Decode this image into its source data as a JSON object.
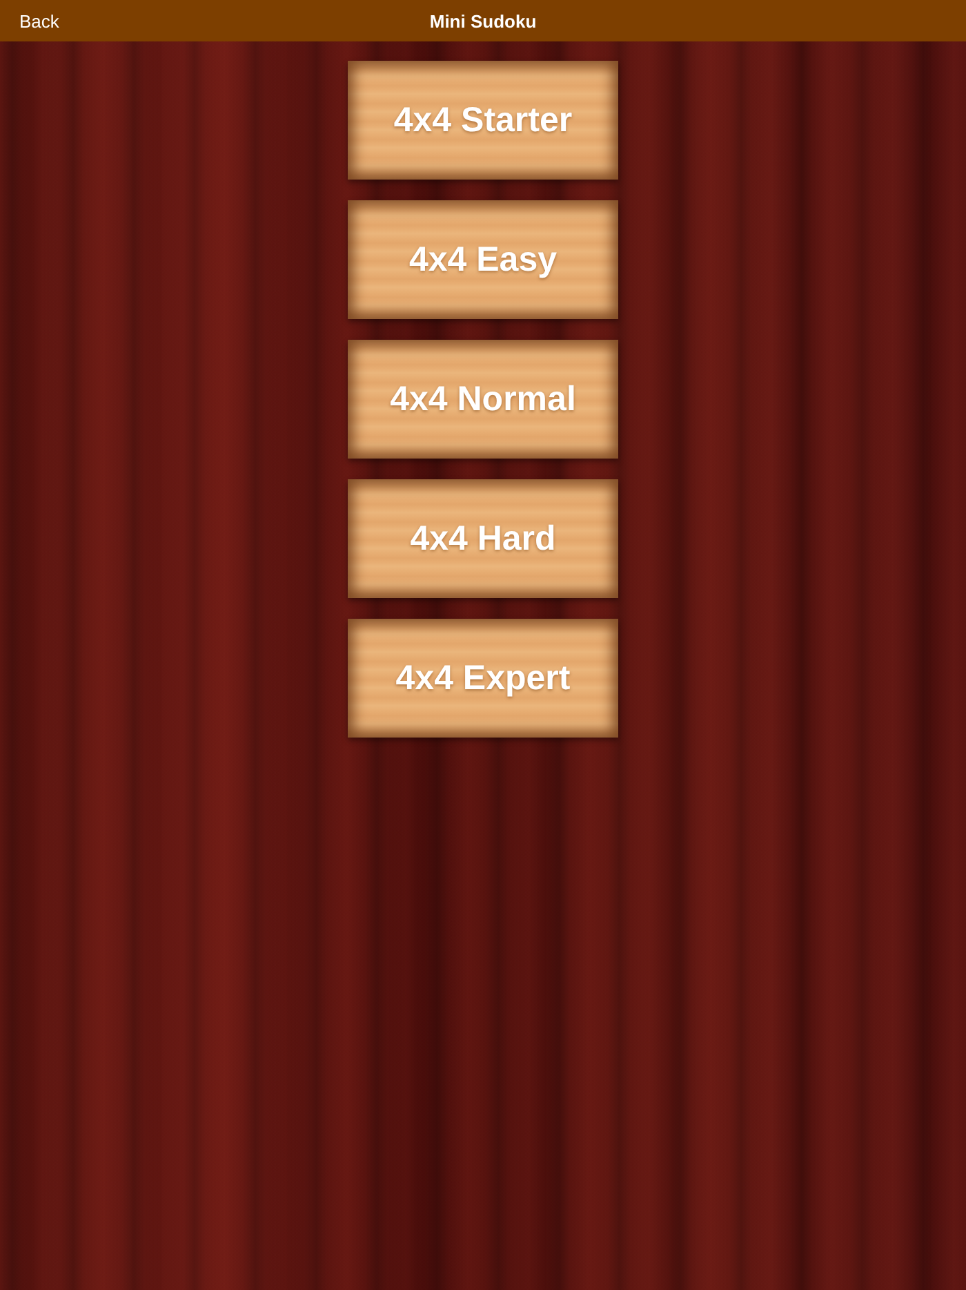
{
  "nav_bar": {
    "back": "Back",
    "title": "Mini Sudoku"
  },
  "levels": [
    "4x4 Starter",
    "4x4 Easy",
    "4x4 Normal",
    "4x4 Hard",
    "4x4 Expert"
  ]
}
